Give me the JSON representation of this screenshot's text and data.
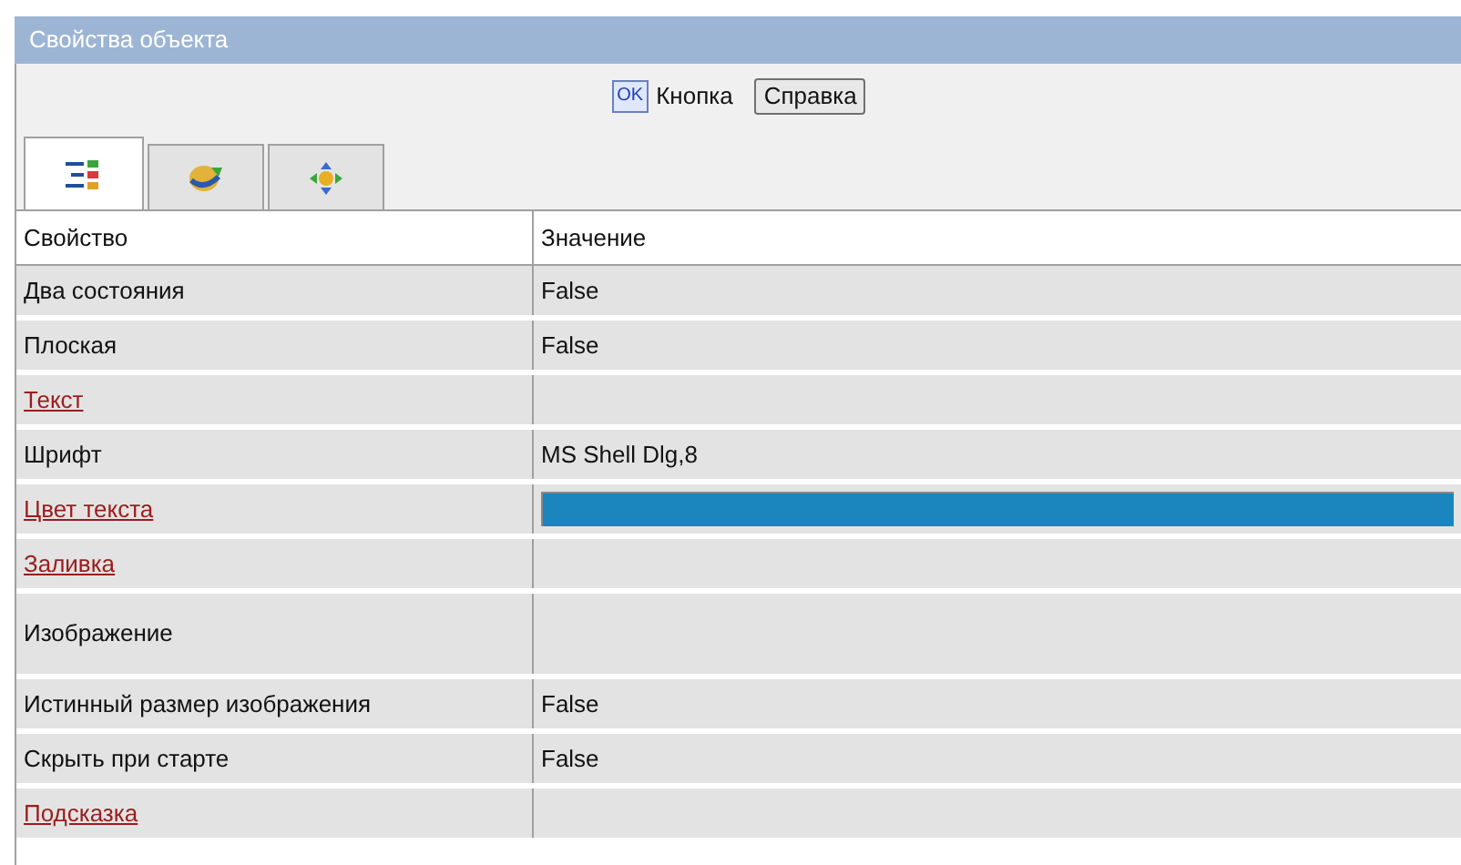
{
  "window": {
    "title": "Свойства объекта"
  },
  "toolbar": {
    "ok_glyph": "OK",
    "label": "Кнопка",
    "help_button": "Справка"
  },
  "tabs": [
    {
      "kind": "list",
      "selected": true
    },
    {
      "kind": "refresh",
      "selected": false
    },
    {
      "kind": "arrows",
      "selected": false
    }
  ],
  "table": {
    "columns": [
      "Свойство",
      "Значение"
    ],
    "rows": [
      {
        "property": "Два состояния",
        "link": false,
        "kind": "text",
        "value": "False"
      },
      {
        "property": "Плоская",
        "link": false,
        "kind": "text",
        "value": "False"
      },
      {
        "property": "Текст",
        "link": true,
        "kind": "empty"
      },
      {
        "property": "Шрифт",
        "link": false,
        "kind": "text",
        "value": "MS Shell Dlg,8"
      },
      {
        "property": "Цвет текста",
        "link": true,
        "kind": "color",
        "color": "#1a86bd"
      },
      {
        "property": "Заливка",
        "link": true,
        "kind": "empty"
      },
      {
        "property": "Изображение",
        "link": false,
        "kind": "image"
      },
      {
        "property": "Истинный размер изображения",
        "link": false,
        "kind": "text",
        "value": "False"
      },
      {
        "property": "Скрыть при старте",
        "link": false,
        "kind": "text",
        "value": "False"
      },
      {
        "property": "Подсказка",
        "link": true,
        "kind": "empty"
      }
    ]
  }
}
